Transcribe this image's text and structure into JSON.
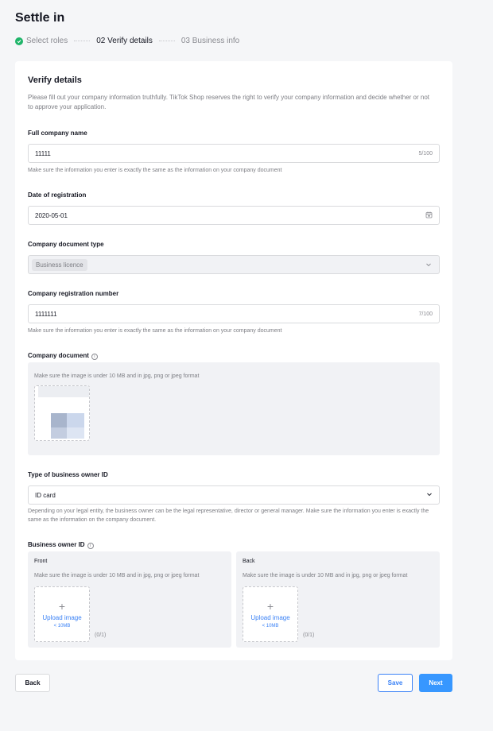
{
  "page": {
    "title": "Settle in"
  },
  "steps": [
    {
      "label": "Select roles"
    },
    {
      "label": "02 Verify details"
    },
    {
      "label": "03 Business info"
    }
  ],
  "form": {
    "title": "Verify details",
    "description": "Please fill out your company information truthfully. TikTok Shop reserves the right to verify your company information and decide whether or not to approve your application.",
    "company_name": {
      "label": "Full company name",
      "value": "11111",
      "counter": "5/100",
      "hint": "Make sure the information you enter is exactly the same as the information on your company document"
    },
    "registration_date": {
      "label": "Date of registration",
      "value": "2020-05-01"
    },
    "document_type": {
      "label": "Company document type",
      "value": "Business licence"
    },
    "registration_number": {
      "label": "Company registration number",
      "value": "1111111",
      "counter": "7/100",
      "hint": "Make sure the information you enter is exactly the same as the information on your company document"
    },
    "company_document": {
      "label": "Company document",
      "hint": "Make sure the image is under 10 MB and in jpg, png or jpeg format"
    },
    "owner_id_type": {
      "label": "Type of business owner ID",
      "value": "ID card",
      "hint": "Depending on your legal entity, the business owner can be the legal representative, director or general manager. Make sure the information you enter is exactly the same as the information on the company document."
    },
    "owner_id": {
      "label": "Business owner ID",
      "front": {
        "title": "Front",
        "hint": "Make sure the image is under 10 MB and in jpg, png or jpeg format",
        "upload_label": "Upload image",
        "size_limit": "< 10MB",
        "count": "(0/1)"
      },
      "back": {
        "title": "Back",
        "hint": "Make sure the image is under 10 MB and in jpg, png or jpeg format",
        "upload_label": "Upload image",
        "size_limit": "< 10MB",
        "count": "(0/1)"
      }
    }
  },
  "buttons": {
    "back": "Back",
    "save": "Save",
    "next": "Next"
  },
  "icons": {
    "step_done": "check-circle-icon",
    "date": "calendar-icon",
    "select": "chevron-down-icon",
    "info": "info-icon",
    "upload": "plus-icon"
  },
  "colors": {
    "primary": "#3797ff",
    "success": "#20b56a",
    "link": "#3b82f6"
  }
}
